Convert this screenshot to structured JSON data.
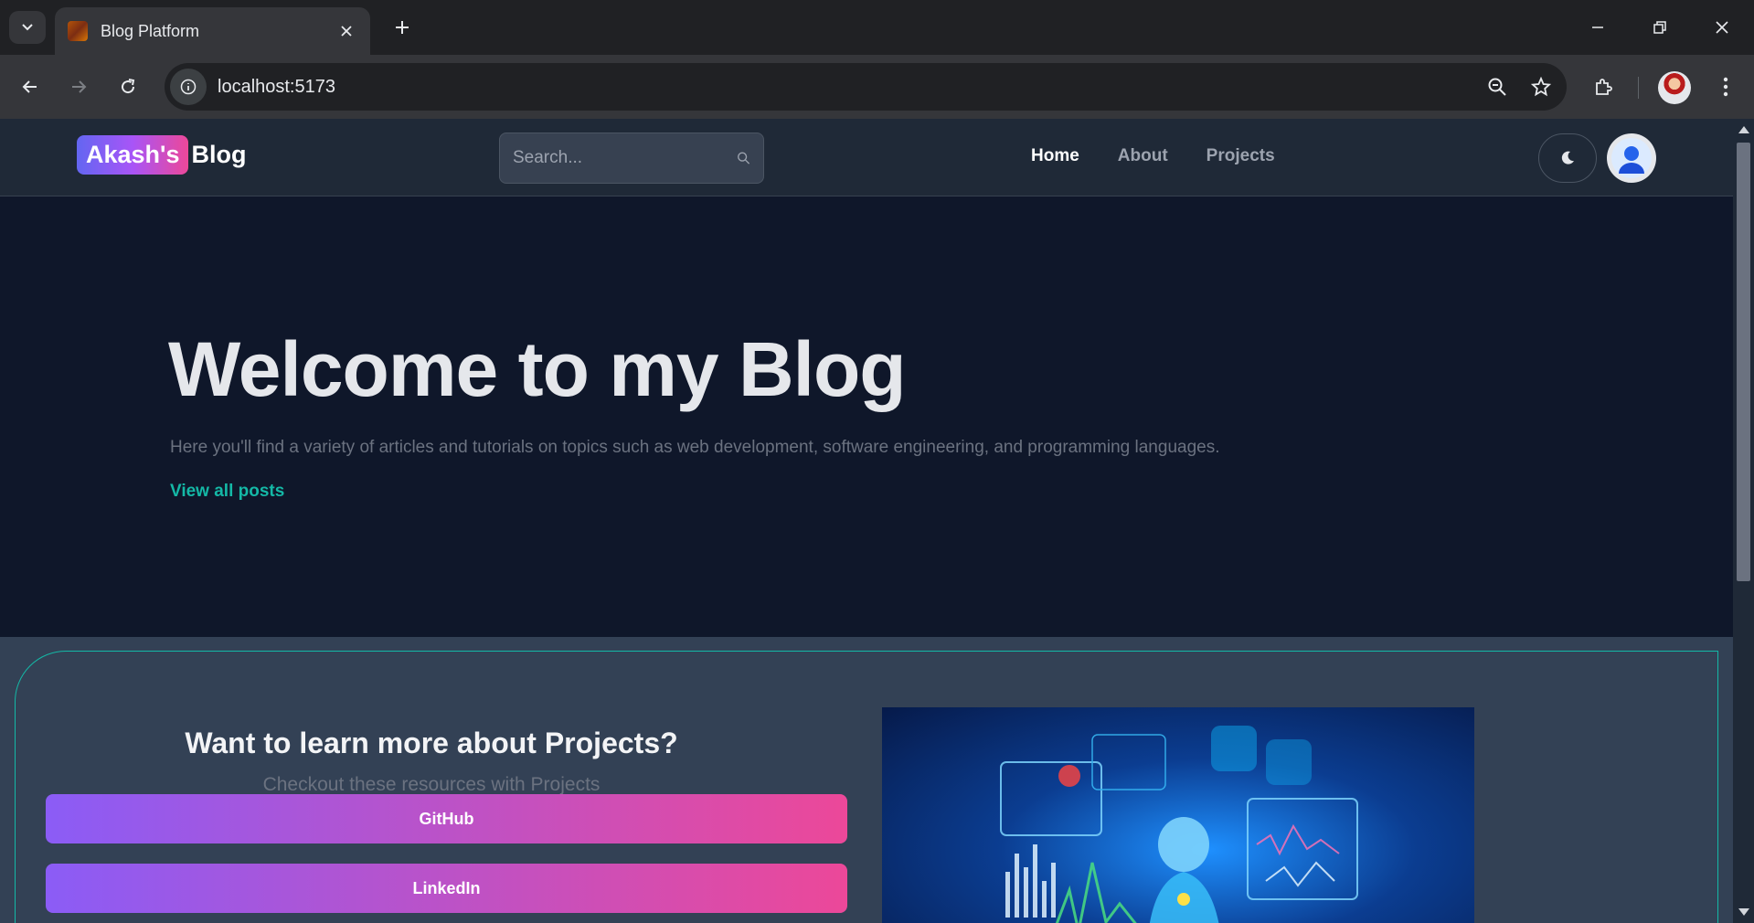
{
  "browser": {
    "tab_title": "Blog Platform",
    "url": "localhost:5173"
  },
  "header": {
    "logo_badge": "Akash's",
    "logo_text": "Blog",
    "search_placeholder": "Search...",
    "nav": [
      {
        "label": "Home",
        "active": true
      },
      {
        "label": "About",
        "active": false
      },
      {
        "label": "Projects",
        "active": false
      }
    ]
  },
  "hero": {
    "title": "Welcome to my Blog",
    "subtitle": "Here you'll find a variety of articles and tutorials on topics such as web development, software engineering, and programming languages.",
    "link": "View all posts"
  },
  "cta": {
    "title": "Want to learn more about Projects?",
    "subtitle": "Checkout these resources with Projects",
    "buttons": [
      "GitHub",
      "LinkedIn"
    ]
  },
  "colors": {
    "accent_teal": "#14b8a6",
    "gradient_start": "#8b5cf6",
    "gradient_end": "#ec4899"
  }
}
